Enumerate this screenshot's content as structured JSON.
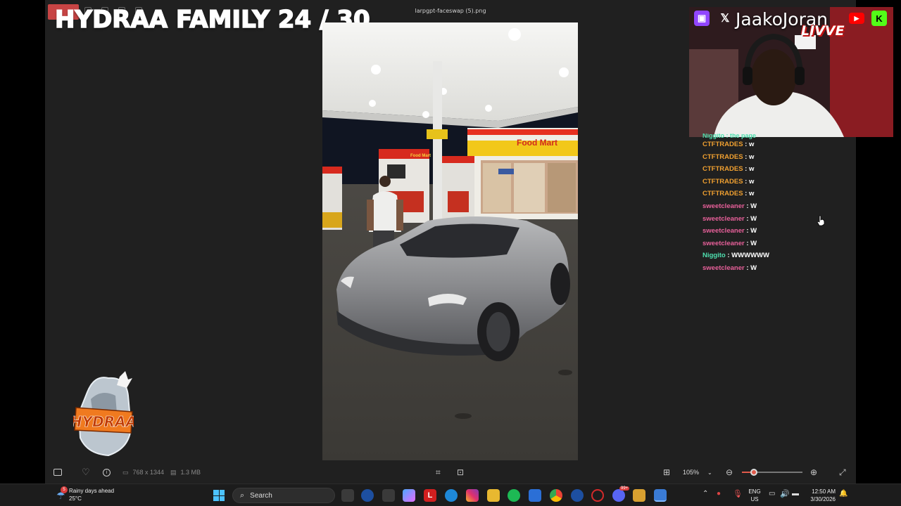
{
  "viewer": {
    "file_title": "larpgpt-faceswap (5).png",
    "image_dimensions": "768 x 1344",
    "file_size": "1.3 MB",
    "zoom_level": "105%",
    "zoom_fraction": 0.2
  },
  "overlay": {
    "title": "HYDRAA FAMILY 24 / 30",
    "logo_text": "HYDRAA",
    "streamer_name": "JaakoJoran",
    "live_badge": "LIVVE"
  },
  "photo_signs": {
    "store_sign": "Food Mart",
    "pump_sign": "Food Mart"
  },
  "chat": {
    "partial_line": "Niggito : the page",
    "messages": [
      {
        "user": "CTFTRADES",
        "text": "w",
        "color": "#f0a030"
      },
      {
        "user": "CTFTRADES",
        "text": "w",
        "color": "#f0a030"
      },
      {
        "user": "CTFTRADES",
        "text": "w",
        "color": "#f0a030"
      },
      {
        "user": "CTFTRADES",
        "text": "w",
        "color": "#f0a030"
      },
      {
        "user": "CTFTRADES",
        "text": "w",
        "color": "#f0a030"
      },
      {
        "user": "sweetcleaner",
        "text": "W",
        "color": "#e8609a"
      },
      {
        "user": "sweetcleaner",
        "text": "W",
        "color": "#e8609a"
      },
      {
        "user": "sweetcleaner",
        "text": "W",
        "color": "#e8609a"
      },
      {
        "user": "sweetcleaner",
        "text": "W",
        "color": "#e8609a"
      },
      {
        "user": "Niggito",
        "text": "WWWWWW",
        "color": "#4fe0b0"
      },
      {
        "user": "sweetcleaner",
        "text": "W",
        "color": "#e8609a"
      }
    ]
  },
  "taskbar": {
    "weather_text": "Rainy days ahead",
    "temperature": "25°C",
    "search_label": "Search",
    "lang_top": "ENG",
    "lang_bottom": "US",
    "time": "12:50 AM",
    "date": "3/30/2026",
    "discord_badge": "99+"
  },
  "icons": {
    "bottom_left": [
      "filmstrip-icon",
      "heart-icon",
      "info-icon"
    ],
    "bottom_center": [
      "crop-icon",
      "enhance-icon"
    ],
    "bottom_right": [
      "fit-icon",
      "zoom-out-icon",
      "zoom-in-icon",
      "fullscreen-icon"
    ]
  },
  "colors": {
    "viewer_bg": "#202020",
    "accent": "#e05a4a",
    "twitch": "#9146ff",
    "youtube": "#ff0000",
    "kick": "#53fc18"
  }
}
